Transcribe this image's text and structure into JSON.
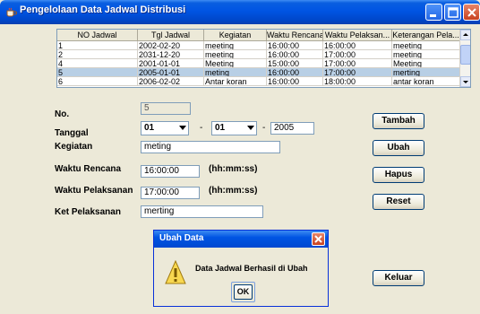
{
  "window": {
    "title": "Pengelolaan Data Jadwal Distribusi"
  },
  "table": {
    "columns": [
      "NO Jadwal",
      "Tgl Jadwal",
      "Kegiatan",
      "Waktu Rencana",
      "Waktu Pelaksan...",
      "Keterangan Pela..."
    ],
    "rows": [
      [
        "1",
        "2002-02-20",
        "meeting",
        "16:00:00",
        "16:00:00",
        "meeting"
      ],
      [
        "2",
        "2031-12-20",
        "meeting",
        "16:00:00",
        "17:00:00",
        "meeting"
      ],
      [
        "4",
        "2001-01-01",
        "Meeting",
        "15:00:00",
        "17:00:00",
        "Meeting"
      ],
      [
        "5",
        "2005-01-01",
        "meting",
        "16:00:00",
        "17:00:00",
        "merting"
      ],
      [
        "6",
        "2006-02-02",
        "Antar koran",
        "16:00:00",
        "18:00:00",
        "antar koran"
      ]
    ],
    "selected_row": 3
  },
  "form": {
    "no_label": "No.",
    "no_value": "5",
    "tanggal_label": "Tanggal",
    "day_value": "01",
    "month_value": "01",
    "dash": "-",
    "year_value": "2005",
    "kegiatan_label": "Kegiatan",
    "kegiatan_value": "meting",
    "waktu_rencana_label": "Waktu Rencana",
    "waktu_rencana_value": "16:00:00",
    "waktu_rencana_hint": "(hh:mm:ss)",
    "waktu_pelaksanan_label": "Waktu Pelaksanan",
    "waktu_pelaksanan_value": "17:00:00",
    "waktu_pelaksanan_hint": "(hh:mm:ss)",
    "ket_label": "Ket Pelaksanan",
    "ket_value": "merting"
  },
  "buttons": {
    "tambah": "Tambah",
    "ubah": "Ubah",
    "hapus": "Hapus",
    "reset": "Reset",
    "keluar": "Keluar"
  },
  "dialog": {
    "title": "Ubah Data",
    "message": "Data Jadwal Berhasil di Ubah",
    "ok": "OK"
  },
  "icons": {
    "app": "java-cup-icon",
    "minimize": "minimize-icon",
    "maximize": "maximize-icon",
    "close": "close-icon",
    "warning": "warning-icon"
  },
  "colors": {
    "titlebar": "#0054e3",
    "selected_row": "#b8cfe5",
    "close_button": "#c8421f"
  }
}
